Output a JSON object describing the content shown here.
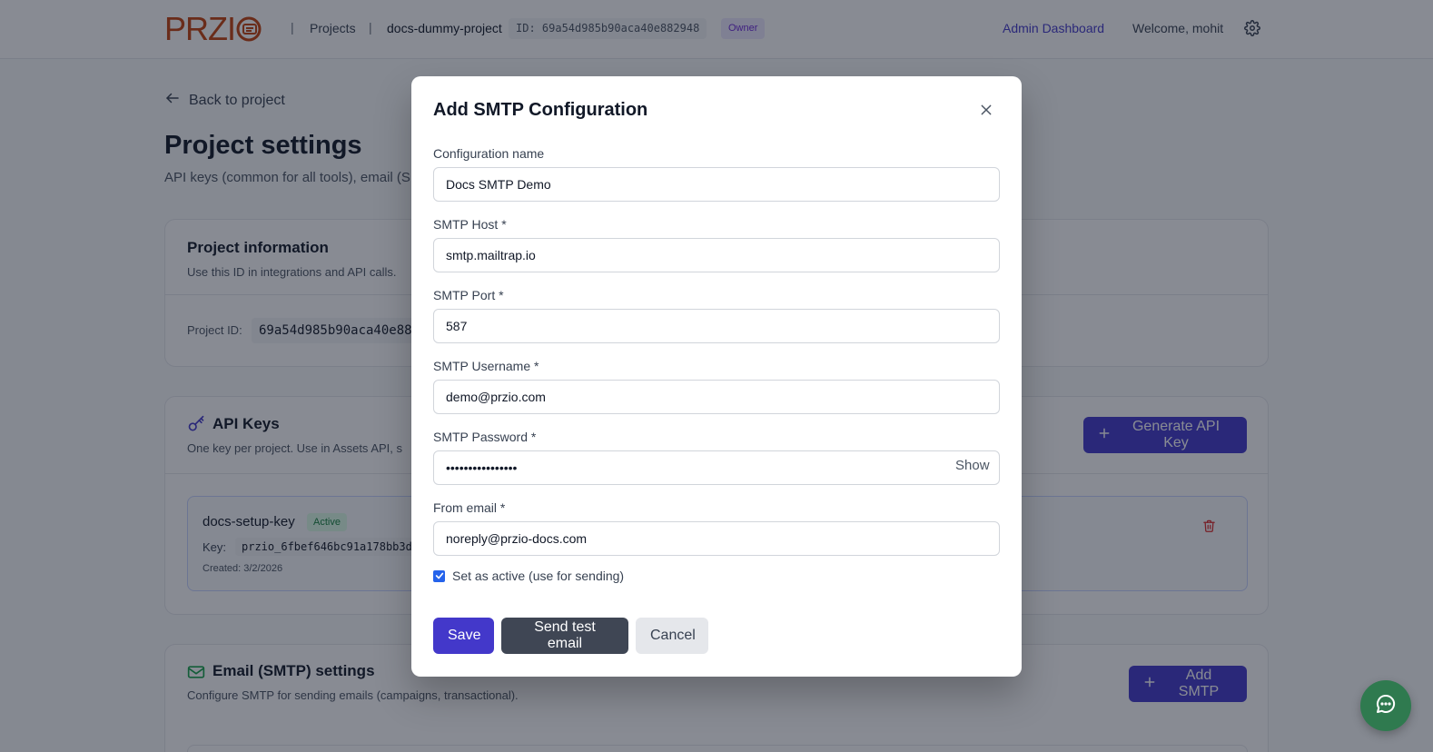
{
  "header": {
    "logo_text": "PRZI",
    "nav_projects": "Projects",
    "project_name": "docs-dummy-project",
    "project_id_chip": "ID: 69a54d985b90aca40e882948",
    "role_badge": "Owner",
    "admin_link": "Admin Dashboard",
    "welcome": "Welcome, mohit",
    "separator": "|"
  },
  "page": {
    "back_label": "Back to project",
    "title": "Project settings",
    "subtitle": "API keys (common for all tools), email (S"
  },
  "project_info": {
    "title": "Project information",
    "subtitle": "Use this ID in integrations and API calls.",
    "id_label": "Project ID:",
    "id_value": "69a54d985b90aca40e88"
  },
  "api_keys": {
    "title": "API Keys",
    "subtitle": "One key per project. Use in Assets API, s",
    "generate_button": "Generate API Key",
    "key": {
      "name": "docs-setup-key",
      "status": "Active",
      "key_label": "Key:",
      "key_value": "przio_6fbef646bc91a178bb3d",
      "created": "Created: 3/2/2026"
    }
  },
  "smtp_settings": {
    "title": "Email (SMTP) settings",
    "subtitle": "Configure SMTP for sending emails (campaigns, transactional).",
    "add_button": "Add SMTP"
  },
  "modal": {
    "title": "Add SMTP Configuration",
    "fields": {
      "config_name": {
        "label": "Configuration name",
        "value": "Docs SMTP Demo"
      },
      "host": {
        "label": "SMTP Host *",
        "value": "smtp.mailtrap.io"
      },
      "port": {
        "label": "SMTP Port *",
        "value": "587"
      },
      "username": {
        "label": "SMTP Username *",
        "value": "demo@przio.com"
      },
      "password": {
        "label": "SMTP Password *",
        "value": "••••••••••••••••",
        "toggle": "Show"
      },
      "from_email": {
        "label": "From email *",
        "value": "noreply@przio-docs.com"
      }
    },
    "active_checkbox": {
      "label": "Set as active (use for sending)",
      "checked": true
    },
    "buttons": {
      "save": "Save",
      "test": "Send test email",
      "cancel": "Cancel"
    }
  },
  "icons": {
    "back": "arrow-left-icon",
    "settings": "gear-icon",
    "key": "key-icon",
    "mail": "mail-icon",
    "plus": "plus-icon",
    "trash": "trash-icon",
    "close": "close-icon",
    "chat": "chat-icon"
  },
  "colors": {
    "primary": "#4338ca",
    "logo": "#c2410c",
    "active_green": "#15803d",
    "danger": "#dc2626",
    "chat": "#2f7a4f",
    "secondary_button": "#3f4654"
  }
}
